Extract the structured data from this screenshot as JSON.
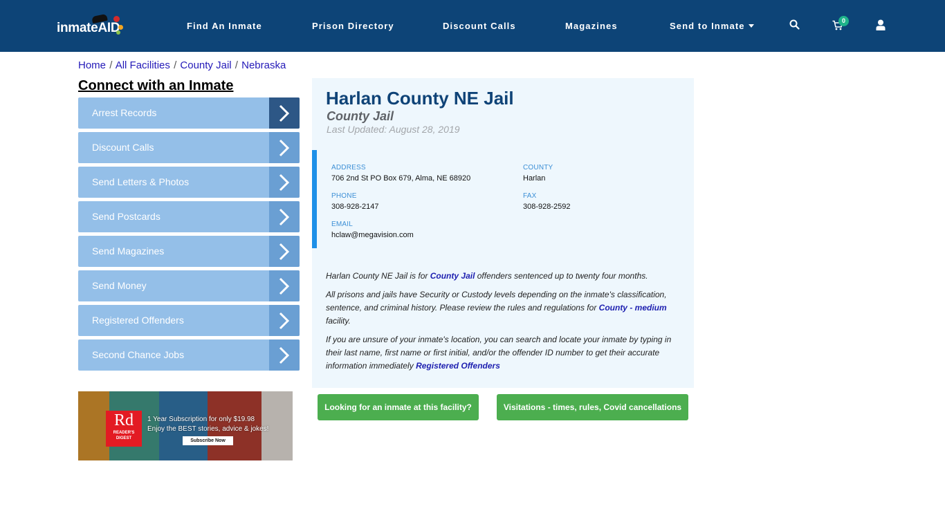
{
  "header": {
    "logo_text": "inmate",
    "logo_accent": "AID",
    "nav": [
      {
        "label": "Find An Inmate"
      },
      {
        "label": "Prison Directory"
      },
      {
        "label": "Discount Calls"
      },
      {
        "label": "Magazines"
      },
      {
        "label": "Send to Inmate"
      }
    ],
    "cart_count": "0",
    "icons": {
      "search": "search-icon",
      "cart": "cart-icon",
      "user": "user-icon",
      "caret": "caret-down-icon"
    }
  },
  "breadcrumb": [
    {
      "label": "Home"
    },
    {
      "label": "All Facilities"
    },
    {
      "label": "County Jail"
    },
    {
      "label": "Nebraska"
    }
  ],
  "breadcrumb_separator": "/",
  "sidebar": {
    "title": "Connect with an Inmate",
    "items": [
      {
        "label": "Arrest Records"
      },
      {
        "label": "Discount Calls"
      },
      {
        "label": "Send Letters & Photos"
      },
      {
        "label": "Send Postcards"
      },
      {
        "label": "Send Magazines"
      },
      {
        "label": "Send Money"
      },
      {
        "label": "Registered Offenders"
      },
      {
        "label": "Second Chance Jobs"
      }
    ],
    "ad": {
      "logo_big": "Rd",
      "logo_small_1": "READER'S",
      "logo_small_2": "DIGEST",
      "line1": "1 Year Subscription for only $19.98",
      "line2": "Enjoy the BEST stories, advice & jokes!",
      "button": "Subscribe Now"
    }
  },
  "facility": {
    "name": "Harlan County NE Jail",
    "type": "County Jail",
    "last_updated": "Last Updated: August 28, 2019",
    "address_label": "ADDRESS",
    "address": "706 2nd St PO Box 679, Alma, NE 68920",
    "county_label": "COUNTY",
    "county": "Harlan",
    "phone_label": "PHONE",
    "phone": "308-928-2147",
    "fax_label": "FAX",
    "fax": "308-928-2592",
    "email_label": "EMAIL",
    "email": "hclaw@megavision.com"
  },
  "description": {
    "p1_before": "Harlan County NE Jail is for ",
    "p1_link": "County Jail",
    "p1_after": " offenders sentenced up to twenty four months.",
    "p2_before": "All prisons and jails have Security or Custody levels depending on the inmate's classification, sentence, and criminal history. Please review the rules and regulations for ",
    "p2_link": "County - medium",
    "p2_after": " facility.",
    "p3_before": "If you are unsure of your inmate's location, you can search and locate your inmate by typing in their last name, first name or first initial, and/or the offender ID number to get their accurate information immediately ",
    "p3_link": "Registered Offenders"
  },
  "buttons": {
    "looking": "Looking for an inmate at this facility?",
    "visitations": "Visitations - times, rules, Covid cancellations"
  },
  "colors": {
    "navbar": "#0d4477",
    "sidebar_item": "#94bfe8",
    "sidebar_chevron": "#6a9fd3",
    "sidebar_chevron_active": "#2d5786",
    "panel_bg": "#eef7fd",
    "accent_border": "#1e90e8",
    "green_button": "#4cae4f",
    "cart_badge": "#1fb38a"
  }
}
